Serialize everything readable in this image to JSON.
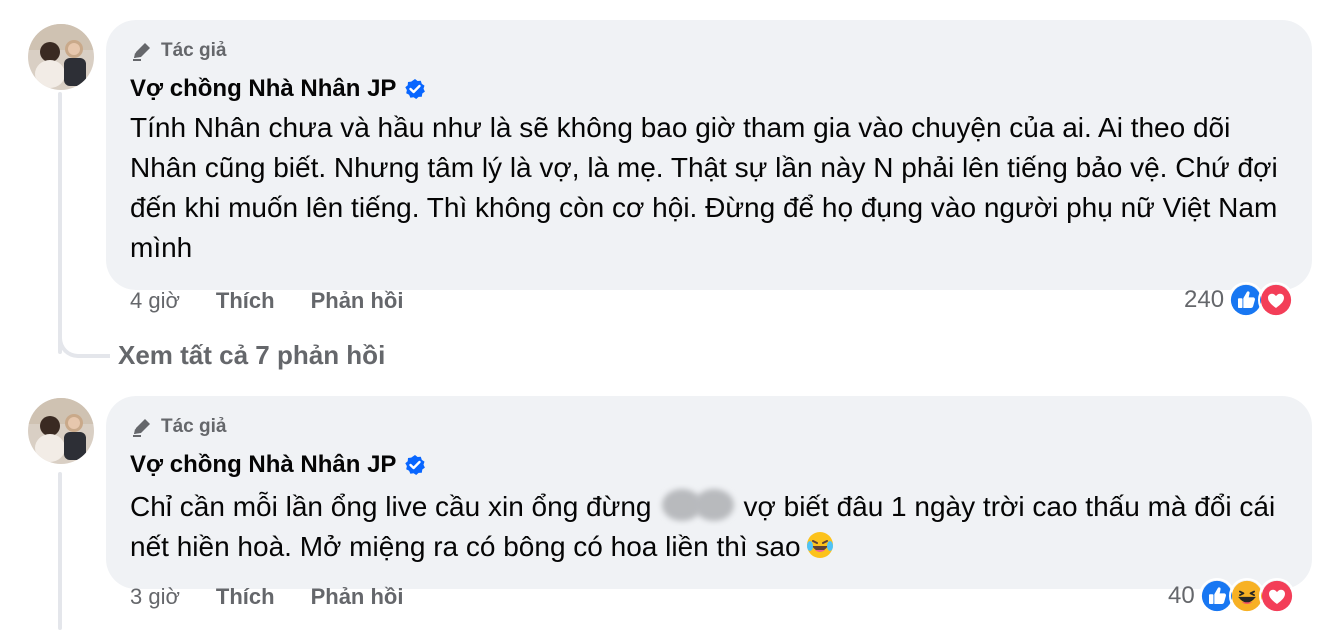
{
  "comments": [
    {
      "badge": "Tác giả",
      "author": "Vợ chồng Nhà Nhân JP",
      "text": "Tính Nhân chưa và hầu như là sẽ không bao giờ tham gia vào chuyện của ai. Ai theo dõi Nhân cũng biết. Nhưng tâm lý là vợ, là mẹ. Thật sự lần này N phải lên tiếng bảo vệ. Chứ đợi đến khi muốn lên tiếng. Thì không còn cơ hội. Đừng để họ đụng vào người phụ nữ Việt Nam mình",
      "time": "4 giờ",
      "like_label": "Thích",
      "reply_label": "Phản hồi",
      "reaction_count": "240",
      "reactions": [
        "like-icon",
        "love-icon"
      ]
    },
    {
      "badge": "Tác giả",
      "author": "Vợ chồng Nhà Nhân JP",
      "text_before_blur": "Chỉ cần mỗi lần ổng live cầu xin ổng đừng",
      "text_after_blur": "vợ biết đâu 1 ngày trời cao thấu mà đổi cái nết hiền hoà. Mở miệng ra có bông có hoa liền thì sao",
      "time": "3 giờ",
      "like_label": "Thích",
      "reply_label": "Phản hồi",
      "reaction_count": "40",
      "reactions": [
        "like-icon",
        "haha-icon",
        "love-icon"
      ]
    }
  ],
  "view_replies": "Xem tất cả 7 phản hồi",
  "colors": {
    "bubble": "#f0f2f5",
    "secondary_text": "#65676b",
    "like_blue": "#1877f2",
    "love_red": "#f33e58",
    "haha_yellow": "#f7b125",
    "verified_blue": "#0866ff"
  }
}
